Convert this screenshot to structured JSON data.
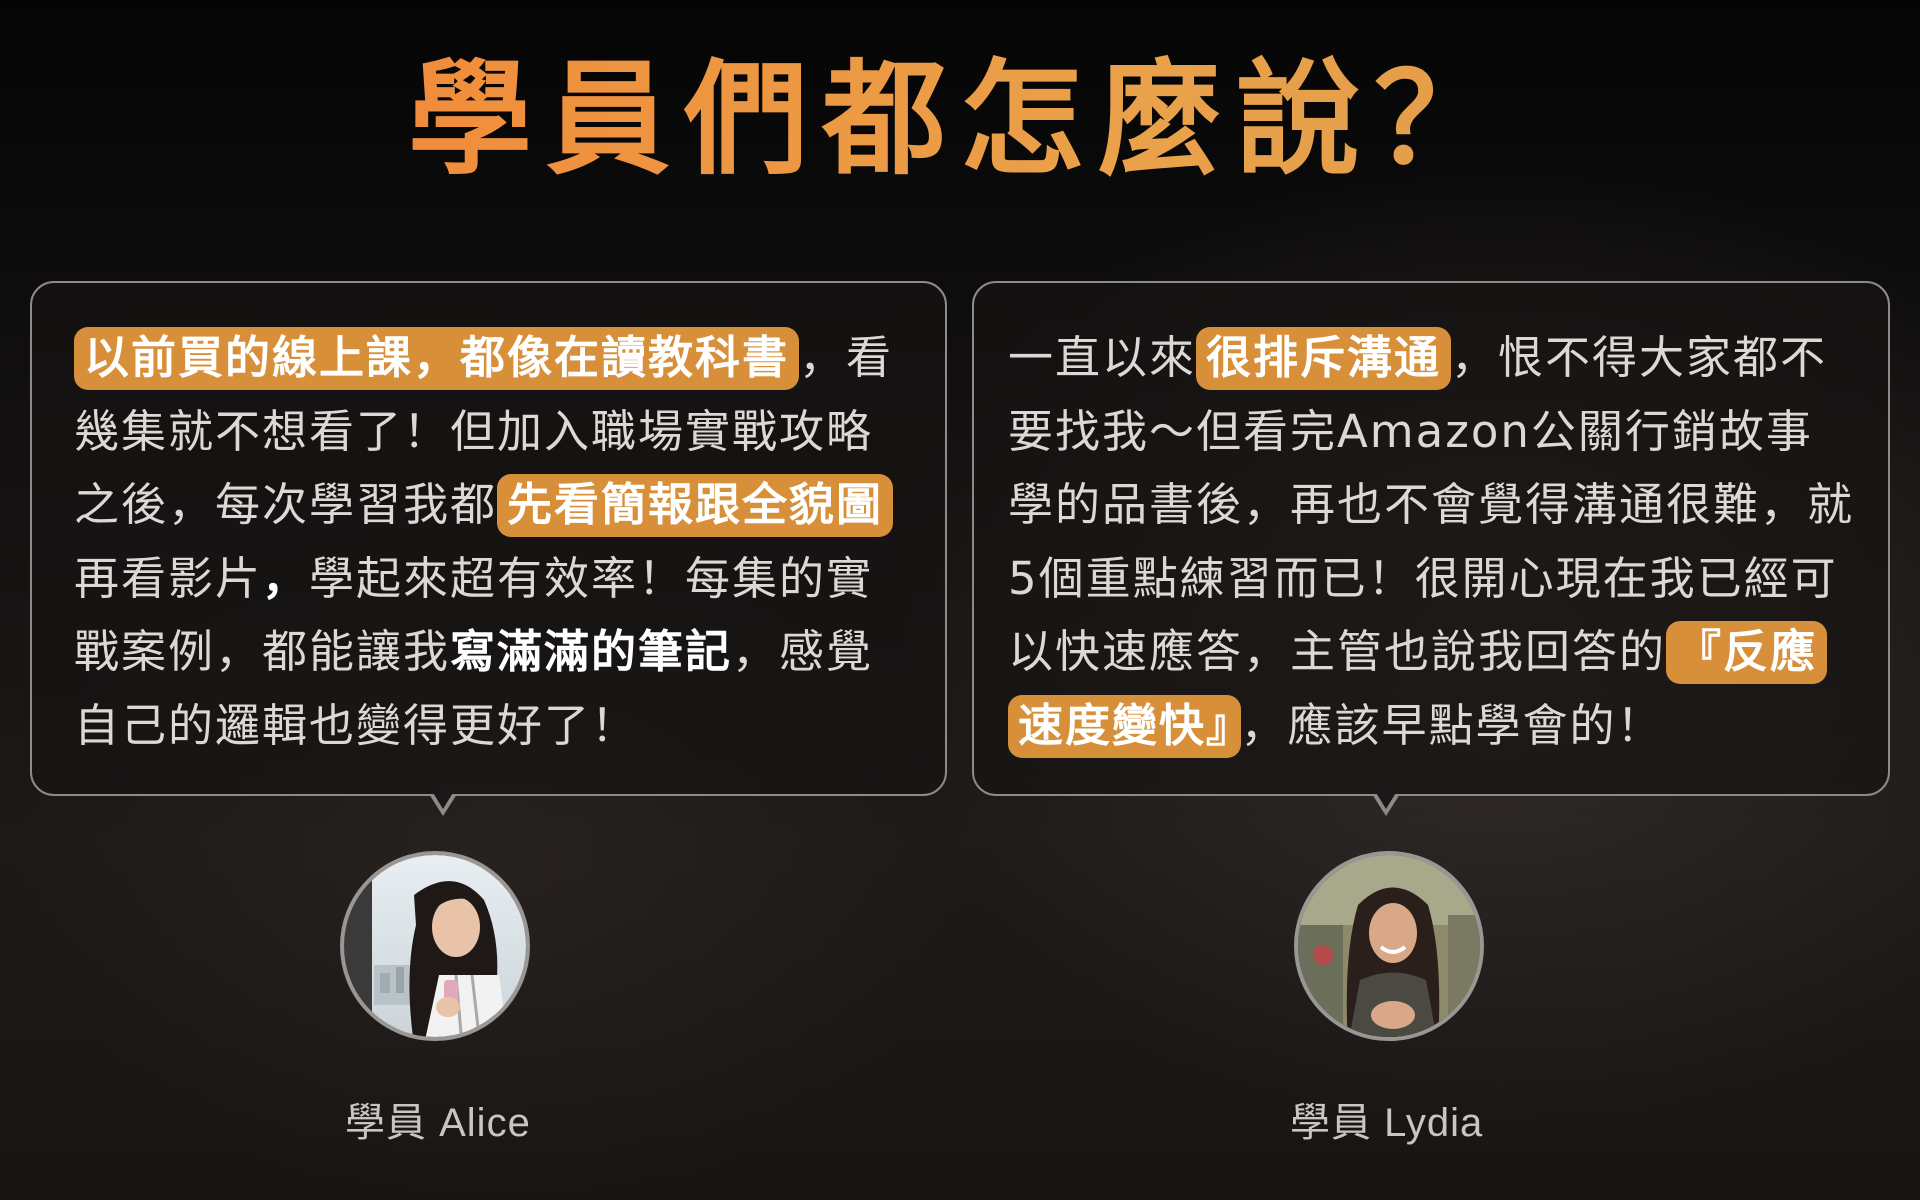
{
  "title": "學員們都怎麼說？",
  "testimonials": [
    {
      "segments": [
        {
          "text": "以前買的線上課，都像在讀教科書",
          "style": "highlight"
        },
        {
          "text": "，看幾集就不想看了！但加入職場實戰攻略之後，每次學習我都",
          "style": "normal"
        },
        {
          "text": "先看簡報跟全貌圖",
          "style": "highlight"
        },
        {
          "text": "再看影片",
          "style": "normal"
        },
        {
          "text": "，",
          "style": "strong"
        },
        {
          "text": "學起來超有效率！每集的實戰案例，都能讓我",
          "style": "normal"
        },
        {
          "text": "寫滿滿的筆記",
          "style": "strong"
        },
        {
          "text": "，感覺自己的邏輯也變得更好了！",
          "style": "normal"
        }
      ],
      "avatar_icon": "student-alice-photo",
      "name": "學員 Alice"
    },
    {
      "segments": [
        {
          "text": "一直以來",
          "style": "normal"
        },
        {
          "text": "很排斥溝通",
          "style": "highlight"
        },
        {
          "text": "，恨不得大家都不要找我～但看完Amazon公關行銷故事學的品書後，再也不會覺得溝通很難，就5個重點練習而已！很開心現在我已經可以快速應答，主管也說我回答的",
          "style": "normal"
        },
        {
          "text": "『反應速度變快』",
          "style": "highlight"
        },
        {
          "text": "，應該早點學會的！",
          "style": "normal"
        }
      ],
      "avatar_icon": "student-lydia-photo",
      "name": "學員  Lydia"
    }
  ],
  "colors": {
    "title_gradient_start": "#f2793a",
    "title_gradient_end": "#e39a4a",
    "highlight": "#d78f3a",
    "bubble_border": "#8f8a88"
  }
}
